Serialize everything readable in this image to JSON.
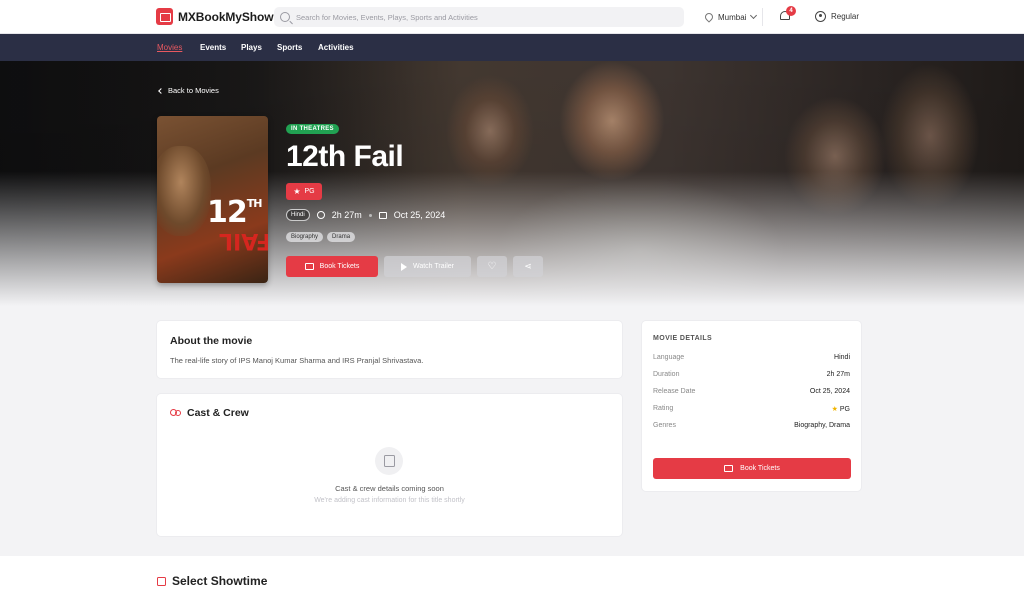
{
  "header": {
    "brand": "MXBookMyShow",
    "search_placeholder": "Search for Movies, Events, Plays, Sports and Activities",
    "city": "Mumbai",
    "notification_count": "4",
    "user_label": "Regular"
  },
  "nav": {
    "items": [
      "Movies",
      "Events",
      "Plays",
      "Sports",
      "Activities"
    ],
    "active": "Movies"
  },
  "hero": {
    "back_label": "Back to Movies",
    "status_badge": "IN THEATRES",
    "title": "12th Fail",
    "rating": "PG",
    "language": "Hindi",
    "duration": "2h 27m",
    "release_date": "Oct 25, 2024",
    "genres": [
      "Biography",
      "Drama"
    ],
    "book_label": "Book Tickets",
    "trailer_label": "Watch Trailer",
    "poster_title": "12",
    "poster_title_sup": "TH",
    "poster_sub": "FAIL"
  },
  "about": {
    "heading": "About the movie",
    "text": "The real-life story of IPS Manoj Kumar Sharma and IRS Pranjal Shrivastava."
  },
  "cast": {
    "heading": "Cast & Crew",
    "message": "Cast & crew details coming soon",
    "sub": "We're adding cast information for this title shortly"
  },
  "details": {
    "heading": "MOVIE DETAILS",
    "rows": [
      {
        "k": "Language",
        "v": "Hindi"
      },
      {
        "k": "Duration",
        "v": "2h 27m"
      },
      {
        "k": "Release Date",
        "v": "Oct 25, 2024"
      },
      {
        "k": "Rating",
        "v": "PG"
      },
      {
        "k": "Genres",
        "v": "Biography, Drama"
      }
    ],
    "book_label": "Book Tickets"
  },
  "showtime": {
    "heading": "Select Showtime"
  },
  "colors": {
    "accent": "#e53b45",
    "nav_bg": "#2b2f45",
    "theatre_badge": "#21a152"
  }
}
